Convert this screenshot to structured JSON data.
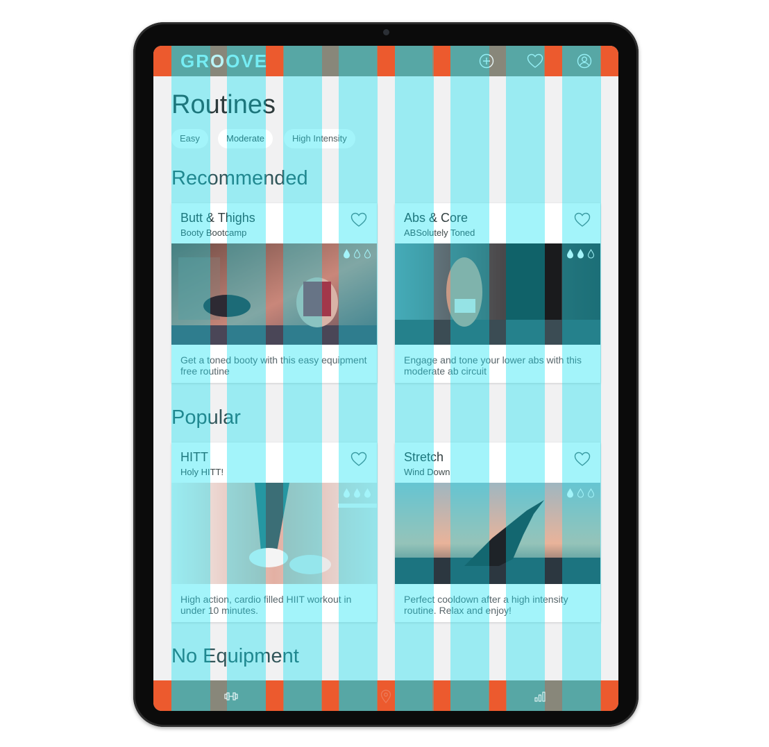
{
  "app": {
    "brand": "GROOVE"
  },
  "header": {
    "icons": [
      "add-circle-icon",
      "heart-icon",
      "user-profile-icon"
    ]
  },
  "page": {
    "title": "Routines"
  },
  "filters": [
    {
      "label": "Easy",
      "selected": false
    },
    {
      "label": "Moderate",
      "selected": true
    },
    {
      "label": "High Intensity",
      "selected": false
    }
  ],
  "sections": [
    {
      "title": "Recommended",
      "cards": [
        {
          "title": "Butt & Thighs",
          "subtitle": "Booty Bootcamp",
          "description": "Get a toned booty with this easy equipment free routine",
          "intensity": 1,
          "intensity_max": 3
        },
        {
          "title": "Abs & Core",
          "subtitle": "ABSolutely Toned",
          "description": "Engage and tone your lower abs with this moderate ab circuit",
          "intensity": 2,
          "intensity_max": 3
        }
      ]
    },
    {
      "title": "Popular",
      "cards": [
        {
          "title": "HITT",
          "subtitle": "Holy HITT!",
          "description": "High action, cardio filled HIIT workout in under 10 minutes.",
          "intensity": 3,
          "intensity_max": 3
        },
        {
          "title": "Stretch",
          "subtitle": "Wind Down",
          "description": "Perfect cooldown after a high intensity routine. Relax and enjoy!",
          "intensity": 1,
          "intensity_max": 3
        }
      ]
    },
    {
      "title": "No Equipment",
      "cards": []
    }
  ],
  "bottom_nav": {
    "icons": [
      "dumbbell-icon",
      "location-pin-icon",
      "stats-bars-icon"
    ]
  },
  "colors": {
    "bar": "#88877a",
    "accent_orange": "#ec5a2e",
    "grid_cyan": "#00e0f0",
    "brand_text": "#b9f4f6"
  }
}
